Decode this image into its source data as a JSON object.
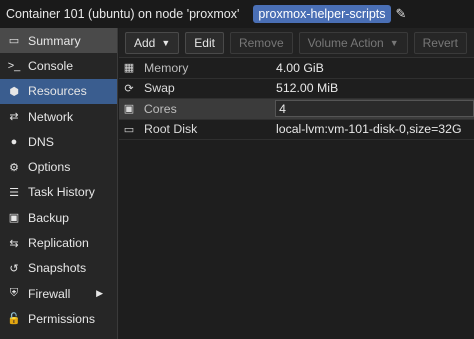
{
  "header": {
    "title": "Container 101 (ubuntu) on node 'proxmox'",
    "tag": "proxmox-helper-scripts"
  },
  "sidebar": {
    "items": [
      {
        "label": "Summary",
        "icon": "summary-icon",
        "glyph": "▭"
      },
      {
        "label": "Console",
        "icon": "console-icon",
        "glyph": ">_"
      },
      {
        "label": "Resources",
        "icon": "cube-icon",
        "glyph": "⬢"
      },
      {
        "label": "Network",
        "icon": "network-icon",
        "glyph": "⇄"
      },
      {
        "label": "DNS",
        "icon": "globe-icon",
        "glyph": "●"
      },
      {
        "label": "Options",
        "icon": "gear-icon",
        "glyph": "⚙"
      },
      {
        "label": "Task History",
        "icon": "list-icon",
        "glyph": "☰"
      },
      {
        "label": "Backup",
        "icon": "save-icon",
        "glyph": "▣"
      },
      {
        "label": "Replication",
        "icon": "retweet-icon",
        "glyph": "⇆"
      },
      {
        "label": "Snapshots",
        "icon": "history-icon",
        "glyph": "↺"
      },
      {
        "label": "Firewall",
        "icon": "shield-icon",
        "glyph": "⛨"
      },
      {
        "label": "Permissions",
        "icon": "unlock-icon",
        "glyph": "🔓"
      }
    ]
  },
  "toolbar": {
    "add_label": "Add",
    "edit_label": "Edit",
    "remove_label": "Remove",
    "volume_action_label": "Volume Action",
    "revert_label": "Revert"
  },
  "resources": {
    "rows": [
      {
        "name": "Memory",
        "value": "4.00 GiB",
        "icon": "memory-icon",
        "glyph": "▦"
      },
      {
        "name": "Swap",
        "value": "512.00 MiB",
        "icon": "refresh-icon",
        "glyph": "⟳"
      },
      {
        "name": "Cores",
        "value": "4",
        "icon": "cpu-icon",
        "glyph": "▣"
      },
      {
        "name": "Root Disk",
        "value": "local-lvm:vm-101-disk-0,size=32G",
        "icon": "hdd-icon",
        "glyph": "▭"
      }
    ]
  },
  "colors": {
    "active_nav": "#3a5d8f",
    "tag_bg": "#4a6fb5"
  }
}
